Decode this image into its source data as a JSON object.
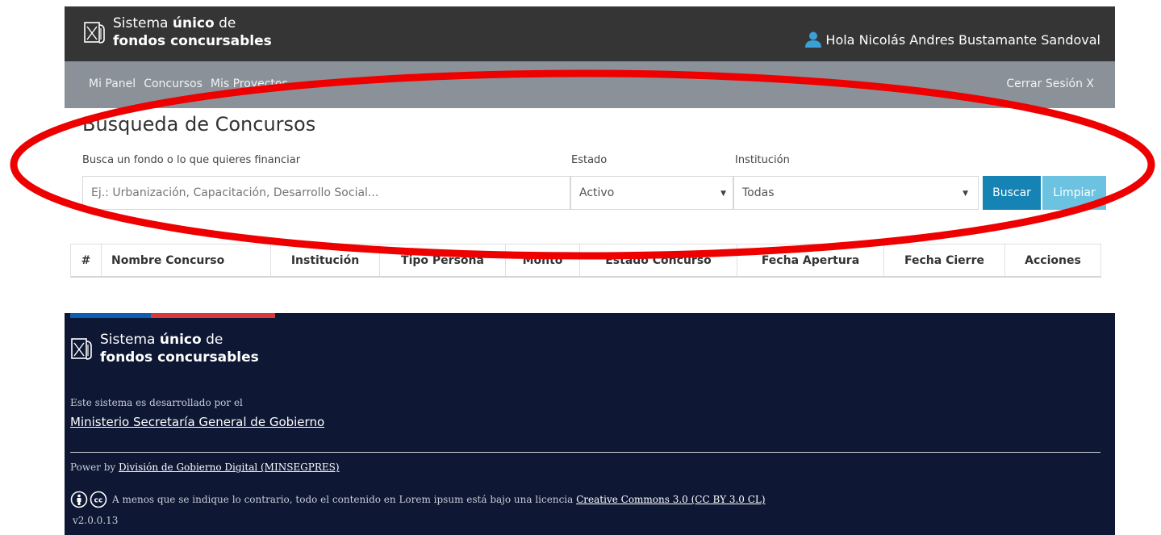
{
  "header": {
    "brand_line1_pre": "Sistema ",
    "brand_line1_bold": "único",
    "brand_line1_post": " de",
    "brand_line2": "fondos concursables",
    "user_greeting": "Hola Nicolás Andres Bustamante Sandoval"
  },
  "nav": {
    "items": [
      "Mi Panel",
      "Concursos",
      "Mis Proyectos"
    ],
    "logout": "Cerrar Sesión X"
  },
  "search": {
    "title": "Búsqueda de Concursos",
    "query_label": "Busca un fondo o lo que quieres financiar",
    "query_placeholder": "Ej.: Urbanización, Capacitación, Desarrollo Social...",
    "estado_label": "Estado",
    "estado_value": "Activo",
    "institucion_label": "Institución",
    "institucion_value": "Todas",
    "buscar": "Buscar",
    "limpiar": "Limpiar"
  },
  "table": {
    "columns": [
      "#",
      "Nombre Concurso",
      "Institución",
      "Tipo Persona",
      "Monto",
      "Estado Concurso",
      "Fecha Apertura",
      "Fecha Cierre",
      "Acciones"
    ]
  },
  "footer": {
    "brand_line1_pre": "Sistema ",
    "brand_line1_bold": "único",
    "brand_line1_post": " de",
    "brand_line2": "fondos concursables",
    "developed_by": "Este sistema es desarrollado por el",
    "ministry": "Ministerio Secretaría General de Gobierno",
    "power_by": "Power by ",
    "power_link": "División de Gobierno Digital (MINSEGPRES)",
    "license_text": "A menos que se indique lo contrario, todo el contenido en Lorem ipsum está bajo una licencia ",
    "license_link": "Creative Commons 3.0 (CC BY 3.0 CL)",
    "version": "v2.0.0.13"
  },
  "colors": {
    "header_bg": "#353535",
    "nav_bg": "#8a9198",
    "buscar_bg": "#1683b5",
    "limpiar_bg": "#6cc3e1",
    "footer_bg": "#0e1733",
    "user_icon": "#3aa0d8",
    "annotation": "#ee0000"
  },
  "icons": [
    "logo-icon",
    "user-icon",
    "chevron-down-icon",
    "cc-attribution-icon",
    "cc-icon"
  ]
}
